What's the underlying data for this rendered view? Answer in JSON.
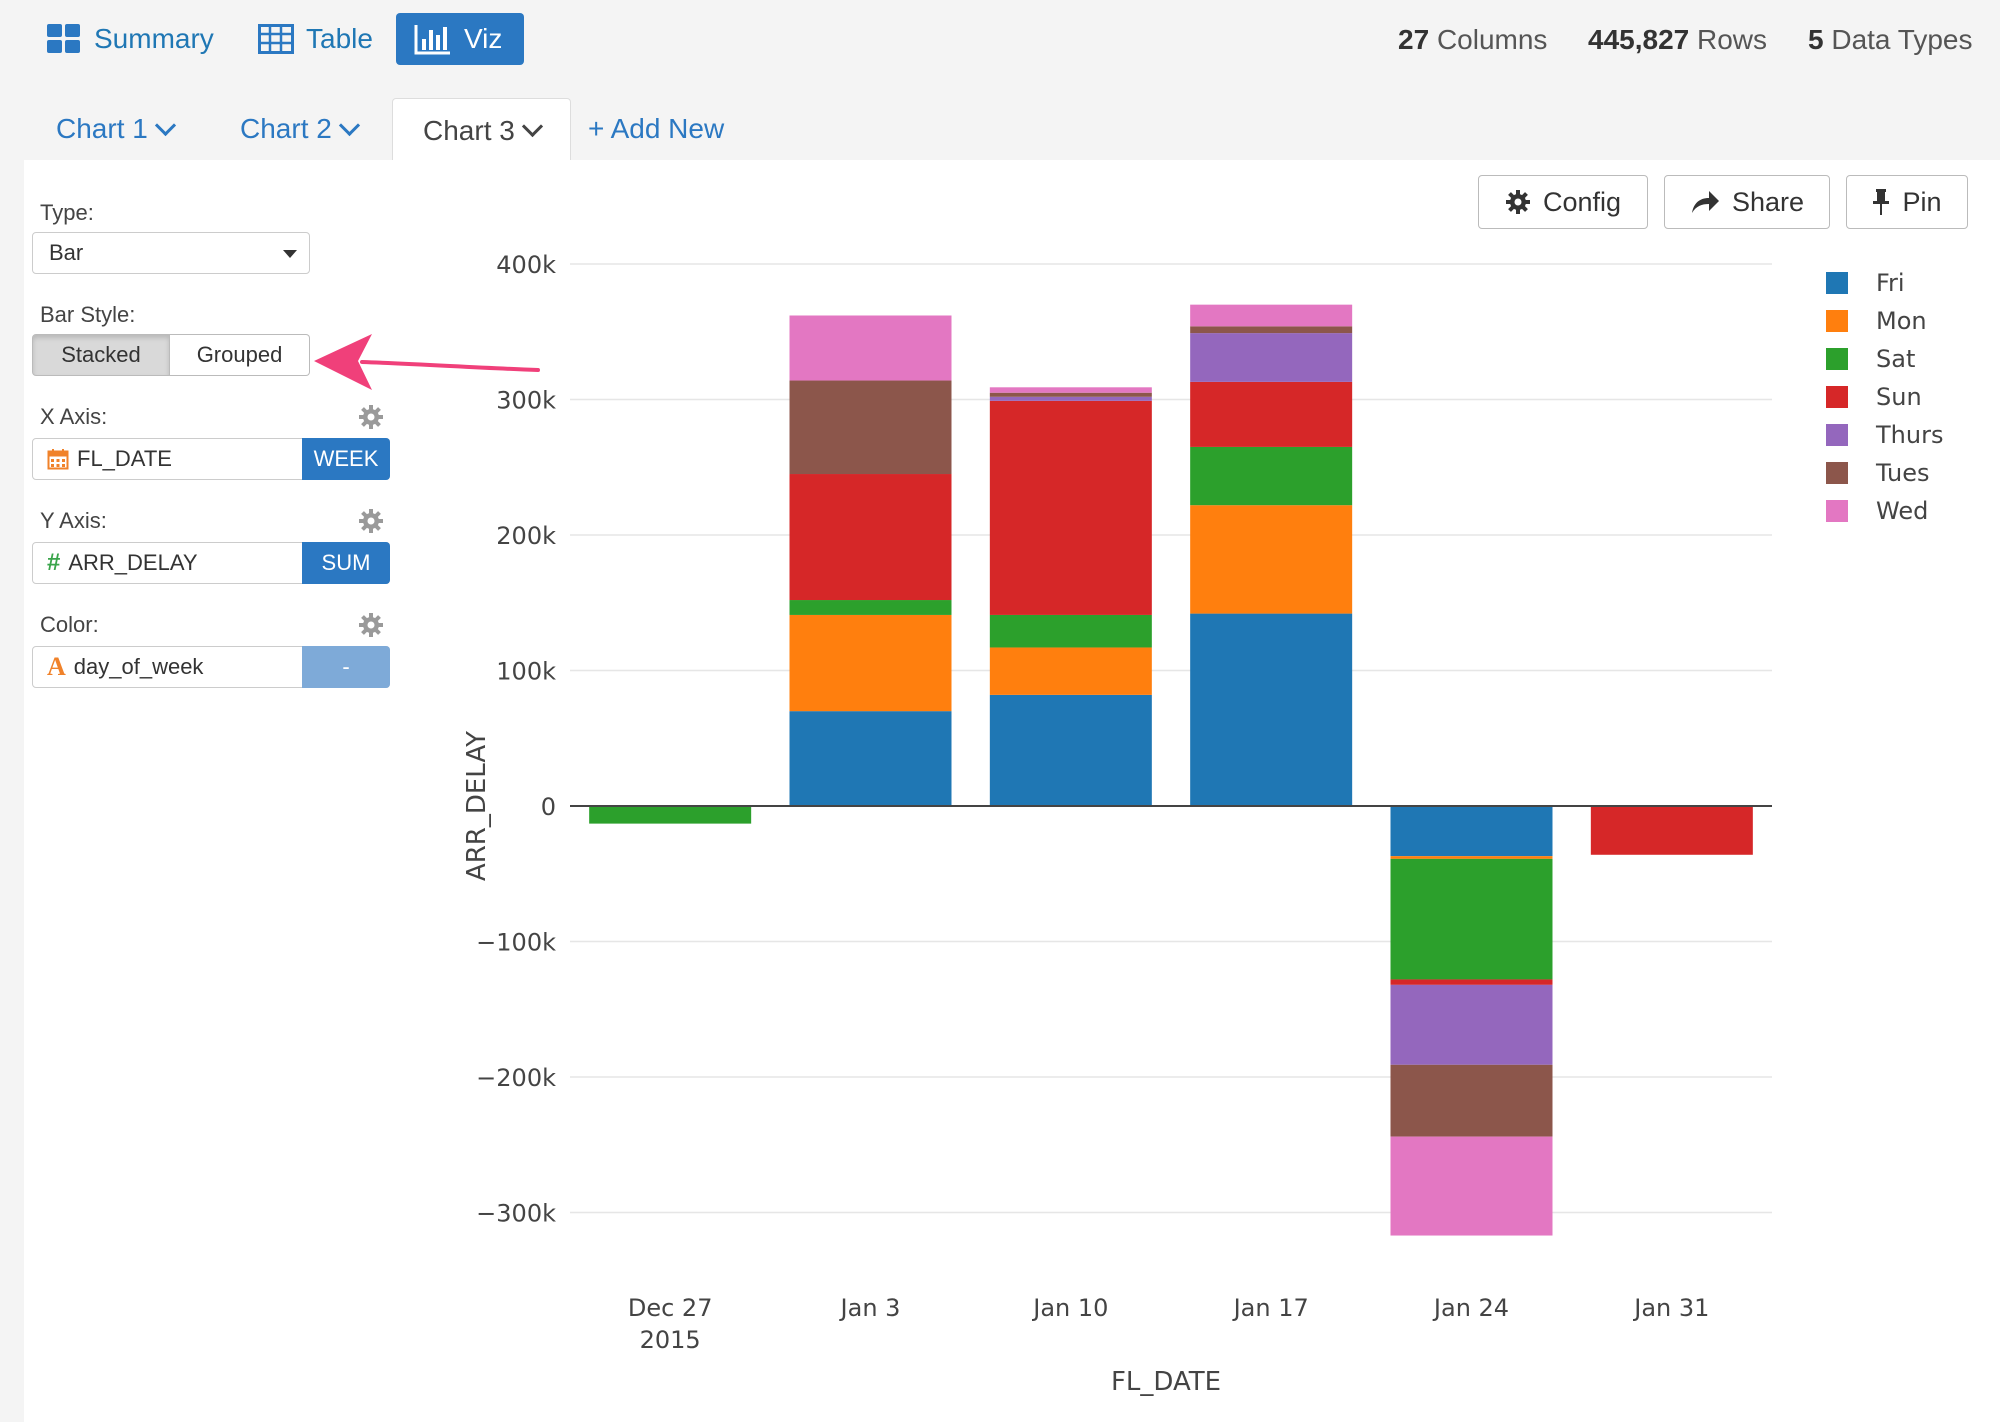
{
  "nav": {
    "summary": "Summary",
    "table": "Table",
    "viz": "Viz"
  },
  "stats": {
    "columns_num": "27",
    "columns_label": "Columns",
    "rows_num": "445,827",
    "rows_label": "Rows",
    "types_num": "5",
    "types_label": "Data Types"
  },
  "tabs": {
    "chart1": "Chart 1",
    "chart2": "Chart 2",
    "chart3": "Chart 3",
    "add_new": "+ Add New"
  },
  "controls": {
    "type_label": "Type:",
    "type_value": "Bar",
    "bar_style_label": "Bar Style:",
    "stacked": "Stacked",
    "grouped": "Grouped",
    "x_axis_label": "X Axis:",
    "x_field": "FL_DATE",
    "x_agg": "WEEK",
    "y_axis_label": "Y Axis:",
    "y_field": "ARR_DELAY",
    "y_agg": "SUM",
    "color_label": "Color:",
    "color_field": "day_of_week",
    "color_agg": "-"
  },
  "actions": {
    "config": "Config",
    "share": "Share",
    "pin": "Pin"
  },
  "colors": {
    "accent": "#2b78c2",
    "arrow": "#f0407a"
  },
  "chart_data": {
    "type": "bar",
    "stacked": true,
    "xlabel": "FL_DATE",
    "ylabel": "ARR_DELAY",
    "categories": [
      "Dec 27 2015",
      "Jan 3",
      "Jan 10",
      "Jan 17",
      "Jan 24",
      "Jan 31"
    ],
    "ylim": [
      -335000,
      415000
    ],
    "yticks": [
      400000,
      300000,
      200000,
      100000,
      0,
      -100000,
      -200000,
      -300000
    ],
    "ytick_labels": [
      "400k",
      "300k",
      "200k",
      "100k",
      "0",
      "−100k",
      "−200k",
      "−300k"
    ],
    "legend_position": "top-right",
    "series": [
      {
        "name": "Fri",
        "color": "#1f77b4",
        "values": [
          0,
          70000,
          82000,
          142000,
          -37000,
          0
        ]
      },
      {
        "name": "Mon",
        "color": "#ff7f0e",
        "values": [
          0,
          71000,
          35000,
          80000,
          -2000,
          0
        ]
      },
      {
        "name": "Sat",
        "color": "#2ca02c",
        "values": [
          -13000,
          11000,
          24000,
          43000,
          -89000,
          0
        ]
      },
      {
        "name": "Sun",
        "color": "#d62728",
        "values": [
          0,
          93000,
          158000,
          48000,
          -4000,
          -36000
        ]
      },
      {
        "name": "Thurs",
        "color": "#9467bd",
        "values": [
          0,
          0,
          3000,
          36000,
          -59000,
          0
        ]
      },
      {
        "name": "Tues",
        "color": "#8c564b",
        "values": [
          0,
          69000,
          3000,
          5000,
          -53000,
          0
        ]
      },
      {
        "name": "Wed",
        "color": "#e377c2",
        "values": [
          0,
          48000,
          4000,
          16000,
          -73000,
          0
        ]
      }
    ]
  }
}
